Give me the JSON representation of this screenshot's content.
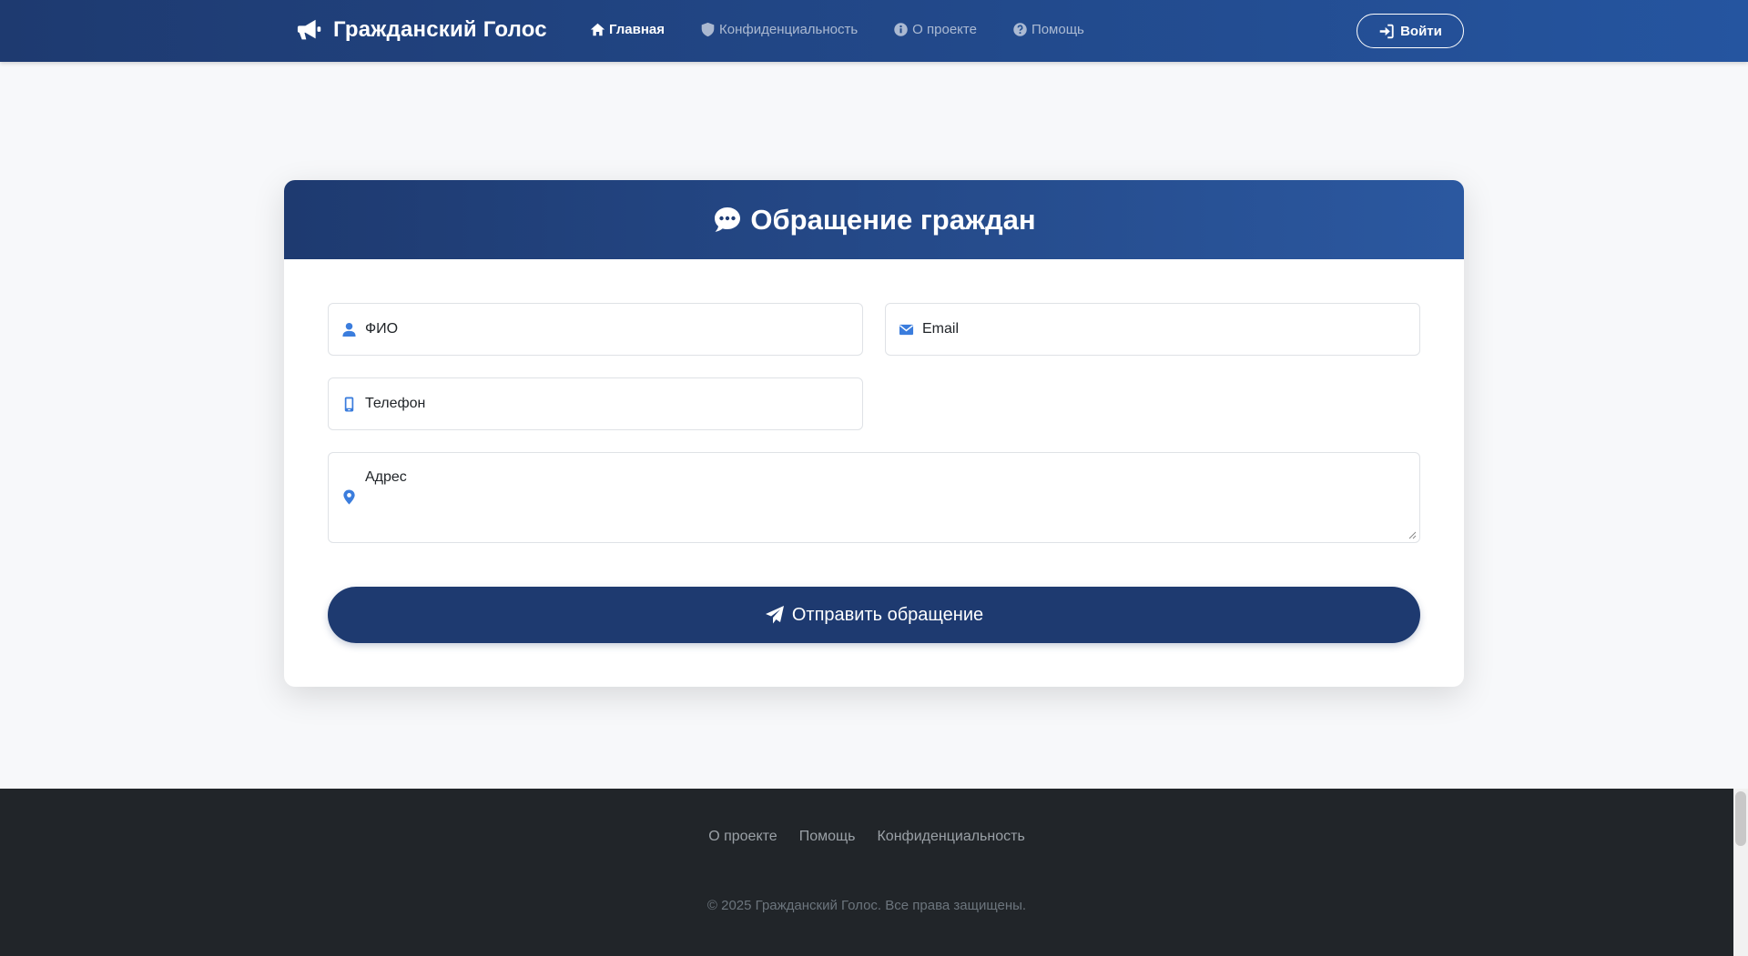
{
  "navbar": {
    "brand": {
      "icon": "megaphone-icon",
      "title": "Гражданский Голос"
    },
    "links": [
      {
        "icon": "home-icon",
        "label": "Главная",
        "active": true
      },
      {
        "icon": "shield-icon",
        "label": "Конфиденциальность",
        "active": false
      },
      {
        "icon": "info-circle-icon",
        "label": "О проекте",
        "active": false
      },
      {
        "icon": "question-circle-icon",
        "label": "Помощь",
        "active": false
      }
    ],
    "login": {
      "icon": "sign-in-icon",
      "label": "Войти"
    }
  },
  "form": {
    "header": {
      "icon": "comment-dots-icon",
      "title": "Обращение граждан"
    },
    "fields": {
      "name": {
        "icon": "user-icon",
        "placeholder": "ФИО",
        "value": ""
      },
      "email": {
        "icon": "envelope-icon",
        "placeholder": "Email",
        "value": ""
      },
      "phone": {
        "icon": "mobile-icon",
        "placeholder": "Телефон",
        "value": ""
      },
      "address": {
        "icon": "map-marker-icon",
        "placeholder": "Адрес",
        "value": ""
      }
    },
    "submit": {
      "icon": "paper-plane-icon",
      "label": "Отправить обращение"
    }
  },
  "footer": {
    "links": [
      "О проекте",
      "Помощь",
      "Конфиденциальность"
    ],
    "copyright": "© 2025 Гражданский Голос. Все права защищены."
  },
  "colors": {
    "navbar_start": "#1e3a70",
    "navbar_end": "#2555a0",
    "primary": "#1e3a70",
    "icon_accent": "#3b7ddd",
    "page_bg": "#f7f8fa",
    "footer_bg": "#212529"
  }
}
